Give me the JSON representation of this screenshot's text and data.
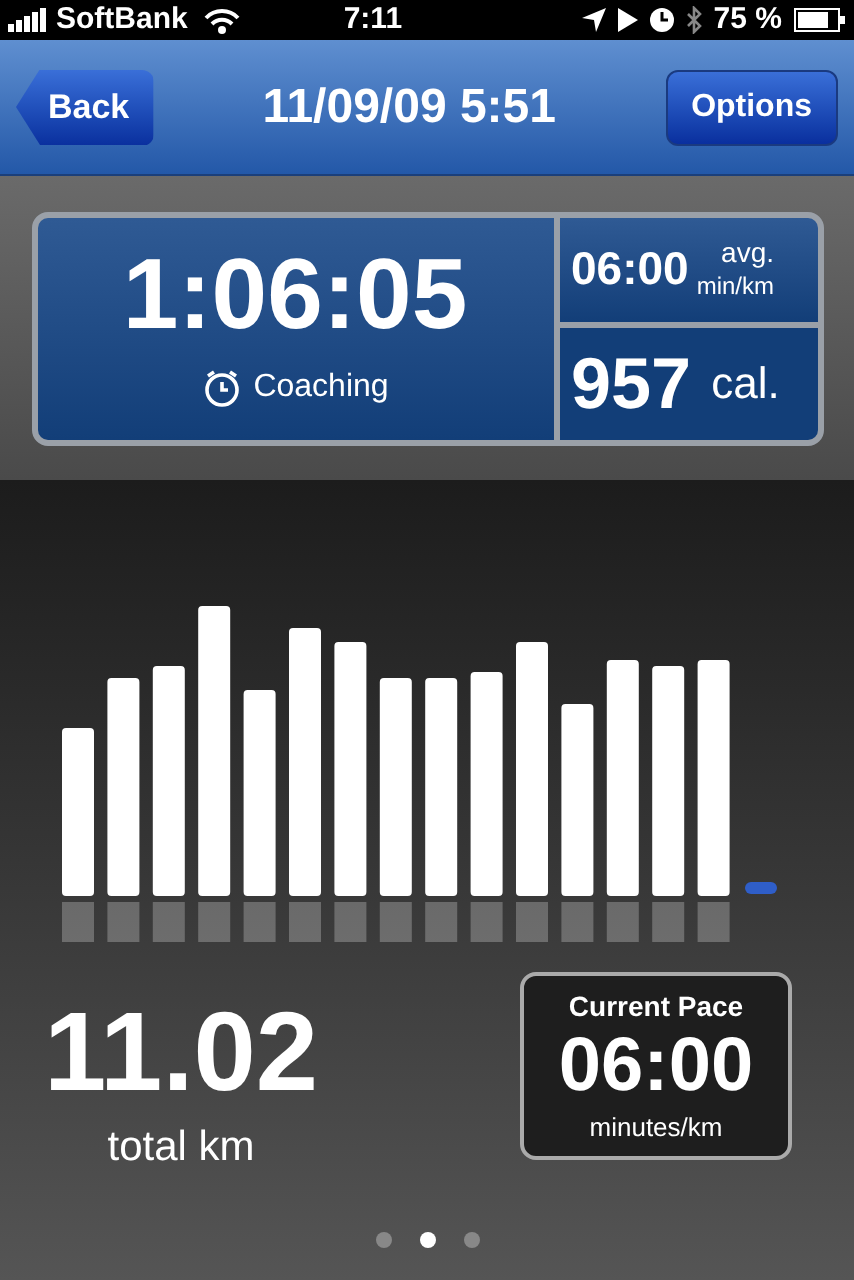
{
  "status_bar": {
    "carrier": "SoftBank",
    "time": "7:11",
    "battery": "75 %"
  },
  "nav": {
    "back": "Back",
    "title": "11/09/09 5:51",
    "options": "Options"
  },
  "summary": {
    "duration": "1:06:05",
    "coaching": "Coaching",
    "pace": "06:00",
    "pace_avg": "avg.",
    "pace_unit": "min/km",
    "calories": "957",
    "calories_unit": "cal."
  },
  "distance": {
    "value": "11.02",
    "unit": "total km"
  },
  "current_pace": {
    "label": "Current Pace",
    "value": "06:00",
    "unit": "minutes/km"
  },
  "page_dots": [
    {
      "selected": false
    },
    {
      "selected": true
    },
    {
      "selected": false
    }
  ]
}
